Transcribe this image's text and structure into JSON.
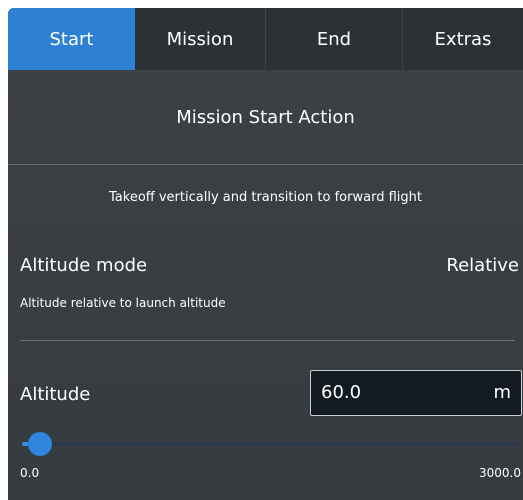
{
  "tabs": [
    {
      "label": "Start",
      "active": true
    },
    {
      "label": "Mission",
      "active": false
    },
    {
      "label": "End",
      "active": false
    },
    {
      "label": "Extras",
      "active": false
    }
  ],
  "section_title": "Mission Start Action",
  "description": "Takeoff vertically and transition to forward flight",
  "altitude_mode": {
    "label": "Altitude mode",
    "value": "Relative",
    "help": "Altitude relative to launch altitude"
  },
  "altitude": {
    "label": "Altitude",
    "value": "60.0",
    "unit": "m"
  },
  "slider": {
    "min_label": "0.0",
    "max_label": "3000.0",
    "min": 0,
    "max": 3000,
    "value": 60
  },
  "colors": {
    "active_tab": "#2d80d2",
    "accent": "#2f86dd",
    "panel_bg": "#3a3f43",
    "field_bg": "#121a22"
  }
}
